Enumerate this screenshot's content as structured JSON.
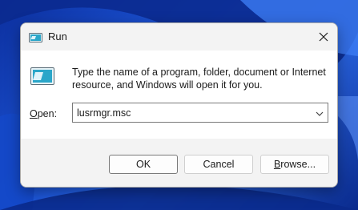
{
  "dialog": {
    "title": "Run",
    "description": "Type the name of a program, folder, document or Internet resource, and Windows will open it for you.",
    "open_label_access": "O",
    "open_label_rest": "pen:",
    "open_value": "lusrmgr.msc",
    "ok_label": "OK",
    "cancel_label": "Cancel",
    "browse_label_access": "B",
    "browse_label_rest": "rowse...",
    "icon": "run-icon",
    "close_icon": "close-icon"
  },
  "colors": {
    "wallpaper_primary": "#1f5be0",
    "dialog_bg": "#f3f3f3",
    "content_bg": "#ffffff",
    "icon_accent": "#2aa6c9"
  }
}
